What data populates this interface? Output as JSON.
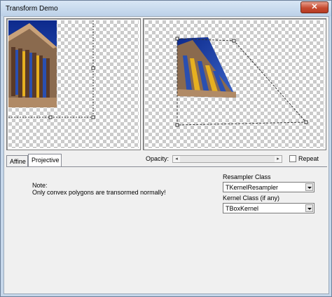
{
  "window": {
    "title": "Transform Demo",
    "close_glyph": "✕"
  },
  "controls": {
    "opacity_label": "Opacity:",
    "opacity_value": 0.0,
    "repeat_label": "Repeat",
    "repeat_checked": false
  },
  "tabs": [
    {
      "label": "Affine",
      "active": false
    },
    {
      "label": "Projective",
      "active": true
    }
  ],
  "projective_pane": {
    "note_title": "Note:",
    "note_text": "Only convex polygons are transormed normally!",
    "resampler_label": "Resampler Class",
    "resampler_value": "TKernelResampler",
    "kernel_label": "Kernel Class (if any)",
    "kernel_value": "TBoxKernel"
  },
  "colors": {
    "title_bg": "#c6d7ea",
    "close_button": "#c74b31",
    "client_bg": "#f0f0f0"
  }
}
